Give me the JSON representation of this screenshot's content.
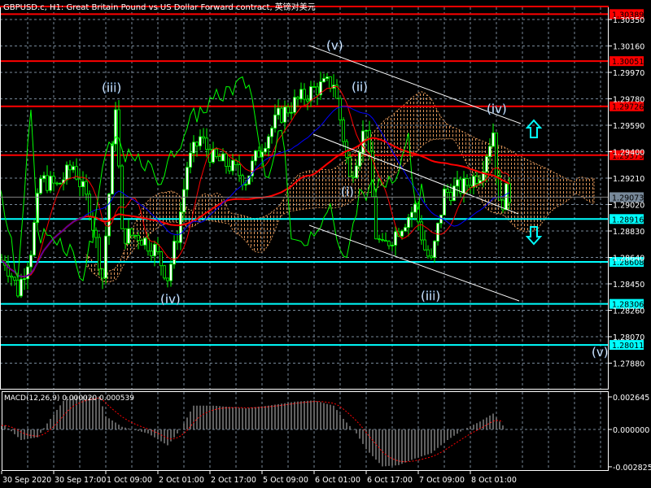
{
  "header": {
    "title": "GBPUSD.c, H1:  Great Britain Pound vs US Dollar Forward contract, 英镑对美元"
  },
  "colors": {
    "background": "#000000",
    "candle_up": "#ffffff",
    "candle_wick": "#00ff00",
    "resistance": "#ff0000",
    "support": "#00ffff",
    "grid": "#778899",
    "cloud": "#f4a460",
    "kijun": "#0000ff",
    "ma": "#ff0000",
    "chikou": "#00ff00"
  },
  "chart_data": {
    "type": "line",
    "title": "GBPUSD.c, H1",
    "ylim": [
      1.278,
      1.3045
    ],
    "y_ticks": [
      "1.30350",
      "1.30160",
      "1.29970",
      "1.29780",
      "1.29590",
      "1.29400",
      "1.29210",
      "1.29020",
      "1.28830",
      "1.28640",
      "1.28450",
      "1.28260",
      "1.28070",
      "1.27880"
    ],
    "x_ticks": [
      "30 Sep 2020",
      "30 Sep 17:00",
      "1 Oct 09:00",
      "2 Oct 01:00",
      "2 Oct 17:00",
      "5 Oct 09:00",
      "6 Oct 01:00",
      "6 Oct 17:00",
      "7 Oct 09:00",
      "8 Oct 01:00"
    ],
    "price_path": {
      "bars": [
        1,
        5,
        9,
        12,
        17,
        22,
        27,
        31,
        34,
        35,
        37,
        42,
        47,
        51,
        54,
        57,
        61,
        65,
        70,
        75,
        80,
        85,
        90,
        96,
        102,
        105,
        107,
        110,
        112,
        115,
        117,
        122,
        127,
        130,
        132,
        136,
        142,
        147,
        151,
        153,
        155,
        156
      ],
      "close": [
        1.2862,
        1.284,
        1.287,
        1.292,
        1.2915,
        1.293,
        1.29,
        1.285,
        1.294,
        1.2975,
        1.288,
        1.288,
        1.287,
        1.285,
        1.288,
        1.293,
        1.295,
        1.2935,
        1.293,
        1.292,
        1.2945,
        1.2965,
        1.2975,
        1.2985,
        1.299,
        1.295,
        1.292,
        1.2945,
        1.296,
        1.288,
        1.287,
        1.2885,
        1.29,
        1.287,
        1.286,
        1.291,
        1.2915,
        1.2925,
        1.2955,
        1.29,
        1.291,
        1.29073
      ]
    },
    "current_price": "1.29073",
    "levels": [
      {
        "label": "1.30389",
        "kind": "resistance"
      },
      {
        "label": "1.30051",
        "kind": "resistance"
      },
      {
        "label": "1.29726",
        "kind": "resistance"
      },
      {
        "label": "1.29375",
        "kind": "resistance"
      },
      {
        "label": "1.28916",
        "kind": "support"
      },
      {
        "label": "1.28608",
        "kind": "support"
      },
      {
        "label": "1.28306",
        "kind": "support"
      },
      {
        "label": "1.28011",
        "kind": "support"
      }
    ],
    "wave_labels": [
      "(v)",
      "(iii)",
      "(ii)",
      "(iv)",
      "(i)",
      "(iv)",
      "(iii)",
      "(v)"
    ],
    "macd": {
      "label": "MACD(12,26,9) 0.000020 0.000539",
      "ylim": [
        -0.002825,
        0.002645
      ],
      "y_ticks": [
        "0.002645",
        "0.000000",
        "-0.002825"
      ],
      "bars": [
        1,
        6,
        11,
        15,
        20,
        30,
        32,
        37,
        45,
        51,
        55,
        59,
        65,
        75,
        82,
        90,
        96,
        102,
        105,
        109,
        112,
        117,
        122,
        127,
        132,
        137,
        142,
        147,
        151,
        154
      ],
      "hist": [
        0.0003,
        -0.0008,
        -0.0006,
        0.0008,
        0.0025,
        0.0025,
        0.001,
        0.0002,
        -0.0003,
        -0.0012,
        0.0,
        0.0018,
        0.0018,
        0.0016,
        0.0018,
        0.0021,
        0.0022,
        0.0018,
        0.0008,
        -0.0003,
        -0.0015,
        -0.0028,
        -0.0027,
        -0.0022,
        -0.0018,
        -0.0008,
        0.0,
        0.0006,
        0.0012,
        0.0003
      ]
    }
  }
}
